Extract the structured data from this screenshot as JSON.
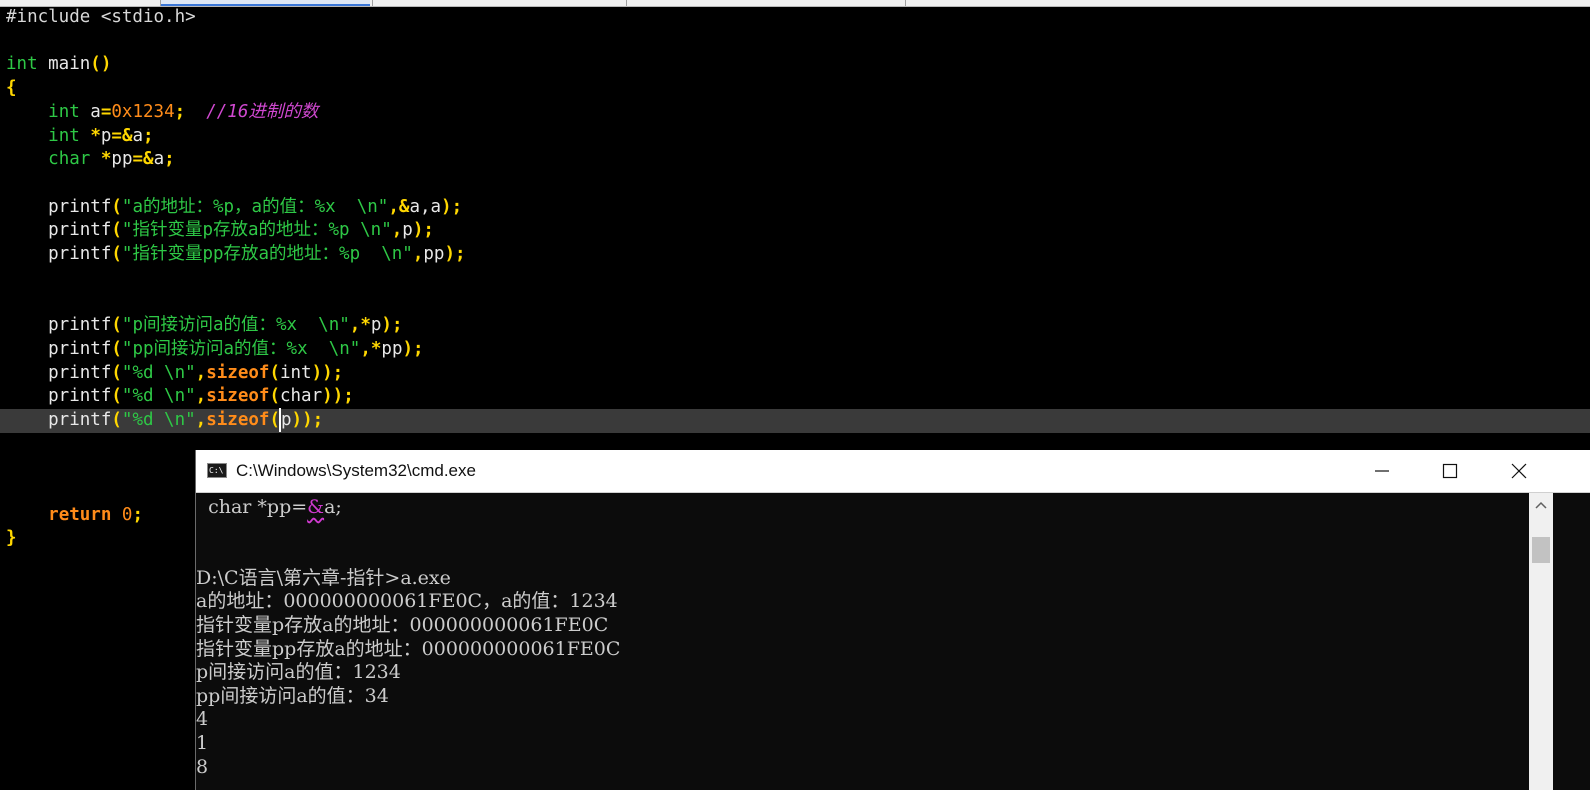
{
  "editor": {
    "lines": [
      [
        {
          "c": "pre",
          "t": "#include <stdio.h>"
        }
      ],
      [],
      [
        {
          "c": "kw",
          "t": "int"
        },
        {
          "c": "plain",
          "t": " main"
        },
        {
          "c": "op",
          "t": "()"
        }
      ],
      [
        {
          "c": "op",
          "t": "{"
        }
      ],
      [
        {
          "c": "plain",
          "t": "    "
        },
        {
          "c": "kw",
          "t": "int"
        },
        {
          "c": "plain",
          "t": " a"
        },
        {
          "c": "op",
          "t": "="
        },
        {
          "c": "num",
          "t": "0x1234"
        },
        {
          "c": "op",
          "t": ";"
        },
        {
          "c": "plain",
          "t": "  "
        },
        {
          "c": "cmt",
          "t": "//16进制的数"
        }
      ],
      [
        {
          "c": "plain",
          "t": "    "
        },
        {
          "c": "kw",
          "t": "int"
        },
        {
          "c": "plain",
          "t": " "
        },
        {
          "c": "op",
          "t": "*"
        },
        {
          "c": "plain",
          "t": "p"
        },
        {
          "c": "op",
          "t": "=&"
        },
        {
          "c": "plain",
          "t": "a"
        },
        {
          "c": "op",
          "t": ";"
        }
      ],
      [
        {
          "c": "plain",
          "t": "    "
        },
        {
          "c": "kw",
          "t": "char"
        },
        {
          "c": "plain",
          "t": " "
        },
        {
          "c": "op",
          "t": "*"
        },
        {
          "c": "plain",
          "t": "pp"
        },
        {
          "c": "op",
          "t": "=&"
        },
        {
          "c": "plain",
          "t": "a"
        },
        {
          "c": "op",
          "t": ";"
        }
      ],
      [],
      [
        {
          "c": "plain",
          "t": "    printf"
        },
        {
          "c": "op",
          "t": "("
        },
        {
          "c": "str",
          "t": "\"a的地址：%p，a的值：%x  \\n\""
        },
        {
          "c": "op",
          "t": ","
        },
        {
          "c": "op",
          "t": "&"
        },
        {
          "c": "plain",
          "t": "a,a"
        },
        {
          "c": "op",
          "t": ");"
        }
      ],
      [
        {
          "c": "plain",
          "t": "    printf"
        },
        {
          "c": "op",
          "t": "("
        },
        {
          "c": "str",
          "t": "\"指针变量p存放a的地址：%p \\n\""
        },
        {
          "c": "op",
          "t": ","
        },
        {
          "c": "plain",
          "t": "p"
        },
        {
          "c": "op",
          "t": ");"
        }
      ],
      [
        {
          "c": "plain",
          "t": "    printf"
        },
        {
          "c": "op",
          "t": "("
        },
        {
          "c": "str",
          "t": "\"指针变量pp存放a的地址：%p  \\n\""
        },
        {
          "c": "op",
          "t": ","
        },
        {
          "c": "plain",
          "t": "pp"
        },
        {
          "c": "op",
          "t": ");"
        }
      ],
      [],
      [],
      [
        {
          "c": "plain",
          "t": "    printf"
        },
        {
          "c": "op",
          "t": "("
        },
        {
          "c": "str",
          "t": "\"p间接访问a的值：%x  \\n\""
        },
        {
          "c": "op",
          "t": ","
        },
        {
          "c": "op",
          "t": "*"
        },
        {
          "c": "plain",
          "t": "p"
        },
        {
          "c": "op",
          "t": ");"
        }
      ],
      [
        {
          "c": "plain",
          "t": "    printf"
        },
        {
          "c": "op",
          "t": "("
        },
        {
          "c": "str",
          "t": "\"pp间接访问a的值：%x  \\n\""
        },
        {
          "c": "op",
          "t": ","
        },
        {
          "c": "op",
          "t": "*"
        },
        {
          "c": "plain",
          "t": "pp"
        },
        {
          "c": "op",
          "t": ");"
        }
      ],
      [
        {
          "c": "plain",
          "t": "    printf"
        },
        {
          "c": "op",
          "t": "("
        },
        {
          "c": "str",
          "t": "\"%d \\n\""
        },
        {
          "c": "op",
          "t": ","
        },
        {
          "c": "kw2",
          "t": "sizeof"
        },
        {
          "c": "op",
          "t": "("
        },
        {
          "c": "plain",
          "t": "int"
        },
        {
          "c": "op",
          "t": "));"
        }
      ],
      [
        {
          "c": "plain",
          "t": "    printf"
        },
        {
          "c": "op",
          "t": "("
        },
        {
          "c": "str",
          "t": "\"%d \\n\""
        },
        {
          "c": "op",
          "t": ","
        },
        {
          "c": "kw2",
          "t": "sizeof"
        },
        {
          "c": "op",
          "t": "("
        },
        {
          "c": "plain",
          "t": "char"
        },
        {
          "c": "op",
          "t": "));"
        }
      ],
      [
        {
          "c": "plain",
          "t": "    printf"
        },
        {
          "c": "op",
          "t": "("
        },
        {
          "c": "str",
          "t": "\"%d \\n\""
        },
        {
          "c": "op",
          "t": ","
        },
        {
          "c": "kw2",
          "t": "sizeof"
        },
        {
          "c": "op",
          "t": "("
        },
        {
          "c": "cursor",
          "t": ""
        },
        {
          "c": "plain",
          "t": "p"
        },
        {
          "c": "op",
          "t": "));"
        }
      ],
      [],
      [],
      [],
      [
        {
          "c": "plain",
          "t": "    "
        },
        {
          "c": "kw2",
          "t": "return"
        },
        {
          "c": "plain",
          "t": " "
        },
        {
          "c": "num",
          "t": "0"
        },
        {
          "c": "op",
          "t": ";"
        }
      ],
      [
        {
          "c": "op",
          "t": "}"
        }
      ]
    ]
  },
  "cmd": {
    "title": "C:\\Windows\\System32\\cmd.exe",
    "icon_text": "C:\\",
    "icon": "console-icon",
    "minimize_icon": "minimize-icon",
    "maximize_icon": "maximize-icon",
    "close_icon": "close-icon",
    "scroll_up_icon": "chevron-up-icon",
    "echo_line": {
      "before": "  char *pp=",
      "amp": "&",
      "after": "a;"
    },
    "output_lines": [
      "",
      "",
      "D:\\C语言\\第六章-指针>a.exe",
      "a的地址：000000000061FE0C，a的值：1234",
      "指针变量p存放a的地址：000000000061FE0C",
      "指针变量pp存放a的地址：000000000061FE0C",
      "p间接访问a的值：1234",
      "pp间接访问a的值：34",
      "4",
      "1",
      "8"
    ]
  },
  "colors": {
    "keyword": "#2ec846",
    "keyword_bold": "#ff8c1a",
    "operator": "#ffd700",
    "number": "#ff8c1a",
    "string": "#2ec846",
    "comment": "#d048d0",
    "editor_background": "#000000",
    "current_line": "#3a3a3a",
    "cmd_background": "#0c0c0c",
    "cmd_text": "#cccccc"
  }
}
